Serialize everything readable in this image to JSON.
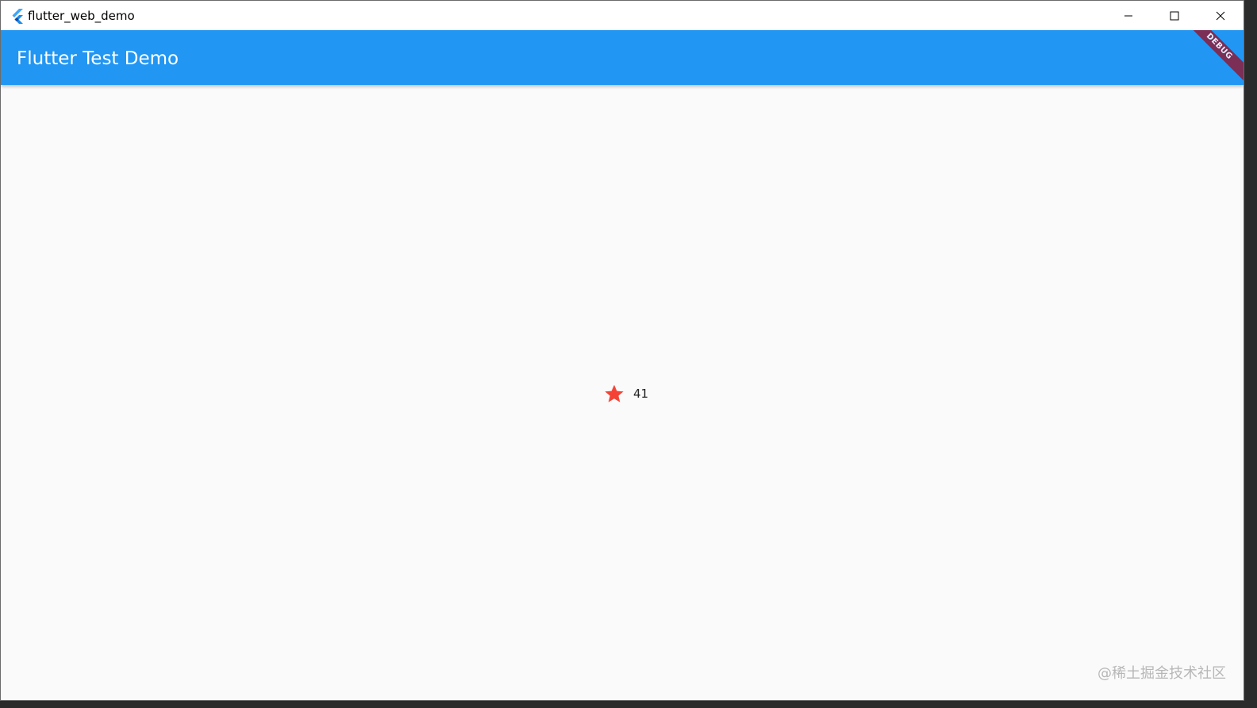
{
  "window": {
    "title": "flutter_web_demo",
    "icons": {
      "app": "flutter-logo-icon",
      "minimize": "minimize-icon",
      "maximize": "maximize-icon",
      "close": "close-icon"
    }
  },
  "appbar": {
    "title": "Flutter Test Demo",
    "background": "#2196f3",
    "debug_banner": "DEBUG"
  },
  "content": {
    "star_icon": "star-icon",
    "star_color": "#f44336",
    "count": "41"
  },
  "watermark": "@稀土掘金技术社区"
}
